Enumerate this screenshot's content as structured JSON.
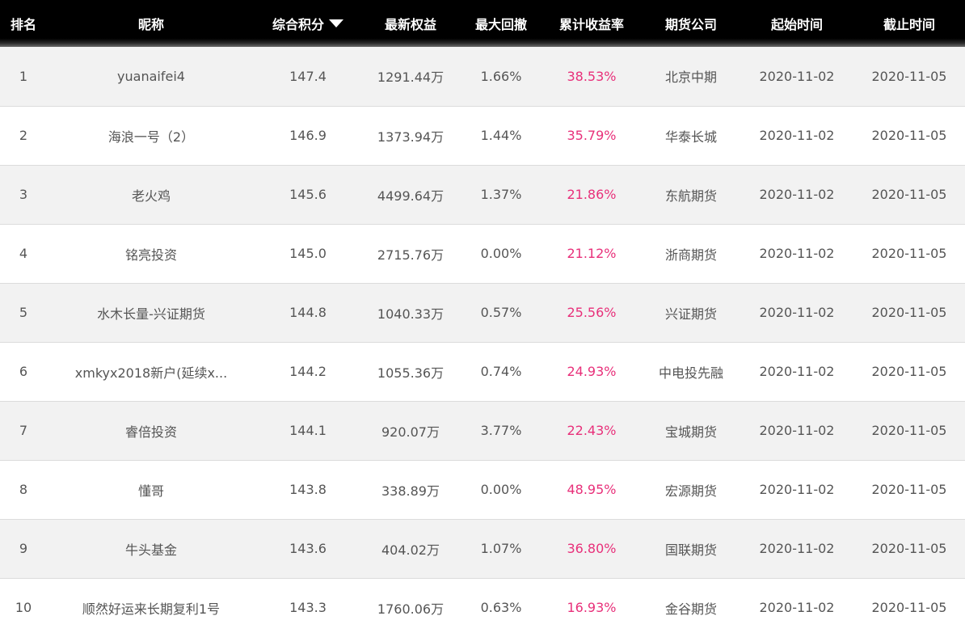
{
  "table": {
    "headers": {
      "rank": "排名",
      "nickname": "昵称",
      "score": "综合积分",
      "equity": "最新权益",
      "drawdown": "最大回撤",
      "return": "累计收益率",
      "broker": "期货公司",
      "start": "起始时间",
      "end": "截止时间"
    },
    "sort": {
      "column": "综合积分",
      "direction": "descending",
      "icon": "caret-down-icon"
    },
    "accent_color": "#e8307a",
    "rows": [
      {
        "rank": "1",
        "nickname": "yuanaifei4",
        "score": "147.4",
        "equity": "1291.44万",
        "drawdown": "1.66%",
        "return": "38.53%",
        "broker": "北京中期",
        "start": "2020-11-02",
        "end": "2020-11-05"
      },
      {
        "rank": "2",
        "nickname": "海浪一号（2）",
        "score": "146.9",
        "equity": "1373.94万",
        "drawdown": "1.44%",
        "return": "35.79%",
        "broker": "华泰长城",
        "start": "2020-11-02",
        "end": "2020-11-05"
      },
      {
        "rank": "3",
        "nickname": "老火鸡",
        "score": "145.6",
        "equity": "4499.64万",
        "drawdown": "1.37%",
        "return": "21.86%",
        "broker": "东航期货",
        "start": "2020-11-02",
        "end": "2020-11-05"
      },
      {
        "rank": "4",
        "nickname": "铭亮投资",
        "score": "145.0",
        "equity": "2715.76万",
        "drawdown": "0.00%",
        "return": "21.12%",
        "broker": "浙商期货",
        "start": "2020-11-02",
        "end": "2020-11-05"
      },
      {
        "rank": "5",
        "nickname": "水木长量-兴证期货",
        "score": "144.8",
        "equity": "1040.33万",
        "drawdown": "0.57%",
        "return": "25.56%",
        "broker": "兴证期货",
        "start": "2020-11-02",
        "end": "2020-11-05"
      },
      {
        "rank": "6",
        "nickname": "xmkyx2018新户(延续x...",
        "score": "144.2",
        "equity": "1055.36万",
        "drawdown": "0.74%",
        "return": "24.93%",
        "broker": "中电投先融",
        "start": "2020-11-02",
        "end": "2020-11-05"
      },
      {
        "rank": "7",
        "nickname": "睿倍投资",
        "score": "144.1",
        "equity": "920.07万",
        "drawdown": "3.77%",
        "return": "22.43%",
        "broker": "宝城期货",
        "start": "2020-11-02",
        "end": "2020-11-05"
      },
      {
        "rank": "8",
        "nickname": "懂哥",
        "score": "143.8",
        "equity": "338.89万",
        "drawdown": "0.00%",
        "return": "48.95%",
        "broker": "宏源期货",
        "start": "2020-11-02",
        "end": "2020-11-05"
      },
      {
        "rank": "9",
        "nickname": "牛头基金",
        "score": "143.6",
        "equity": "404.02万",
        "drawdown": "1.07%",
        "return": "36.80%",
        "broker": "国联期货",
        "start": "2020-11-02",
        "end": "2020-11-05"
      },
      {
        "rank": "10",
        "nickname": "顺然好运来长期复利1号",
        "score": "143.3",
        "equity": "1760.06万",
        "drawdown": "0.63%",
        "return": "16.93%",
        "broker": "金谷期货",
        "start": "2020-11-02",
        "end": "2020-11-05"
      }
    ]
  }
}
